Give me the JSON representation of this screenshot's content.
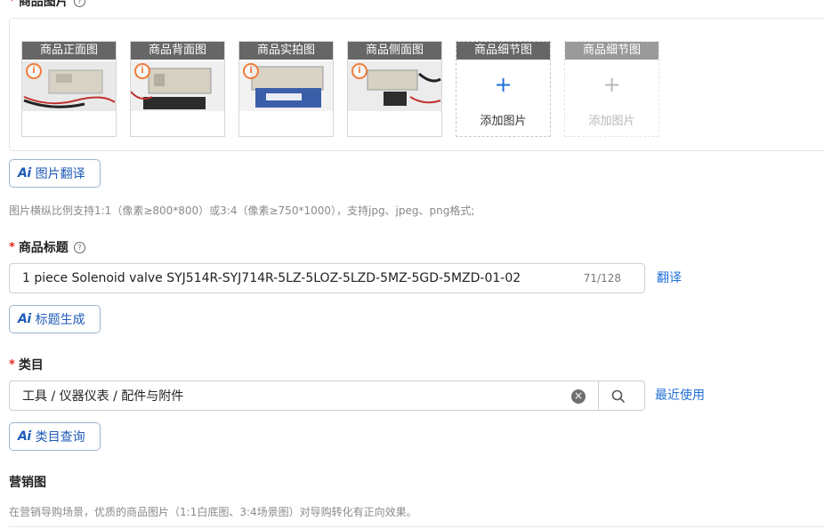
{
  "images": {
    "label": "商品图片",
    "slots": [
      {
        "title": "商品正面图"
      },
      {
        "title": "商品背面图"
      },
      {
        "title": "商品实拍图"
      },
      {
        "title": "商品侧面图"
      }
    ],
    "detail_slots": [
      {
        "title": "商品细节图",
        "add_label": "添加图片",
        "plus": "+"
      },
      {
        "title": "商品细节图",
        "add_label": "添加图片",
        "plus": "+"
      }
    ],
    "info_glyph": "i",
    "ai_translate": {
      "mark": "Ai",
      "label": "图片翻译"
    },
    "hint": "图片横纵比例支持1:1（像素≥800*800）或3:4（像素≥750*1000），支持jpg、jpeg、png格式;"
  },
  "title_section": {
    "required_mark": "*",
    "label": "商品标题",
    "help_glyph": "?",
    "value": "1 piece Solenoid valve SYJ514R-SYJ714R-5LZ-5LOZ-5LZD-5MZ-5GD-5MZD-01-02",
    "counter": "71/128",
    "translate_link": "翻译",
    "ai_generate": {
      "mark": "Ai",
      "label": "标题生成"
    }
  },
  "category": {
    "required_mark": "*",
    "label": "类目",
    "value": "工具 / 仪器仪表 / 配件与附件",
    "recent_link": "最近使用",
    "ai_query": {
      "mark": "Ai",
      "label": "类目查询"
    },
    "clear_glyph": "×"
  },
  "marketing": {
    "label": "营销图",
    "hint": "在营销导购场景，优质的商品图片（1:1白底图、3:4场景图）对导购转化有正向效果。"
  },
  "colors": {
    "accent": "#1f6fd8",
    "required": "#e0281e",
    "badge": "#f07c3a"
  }
}
